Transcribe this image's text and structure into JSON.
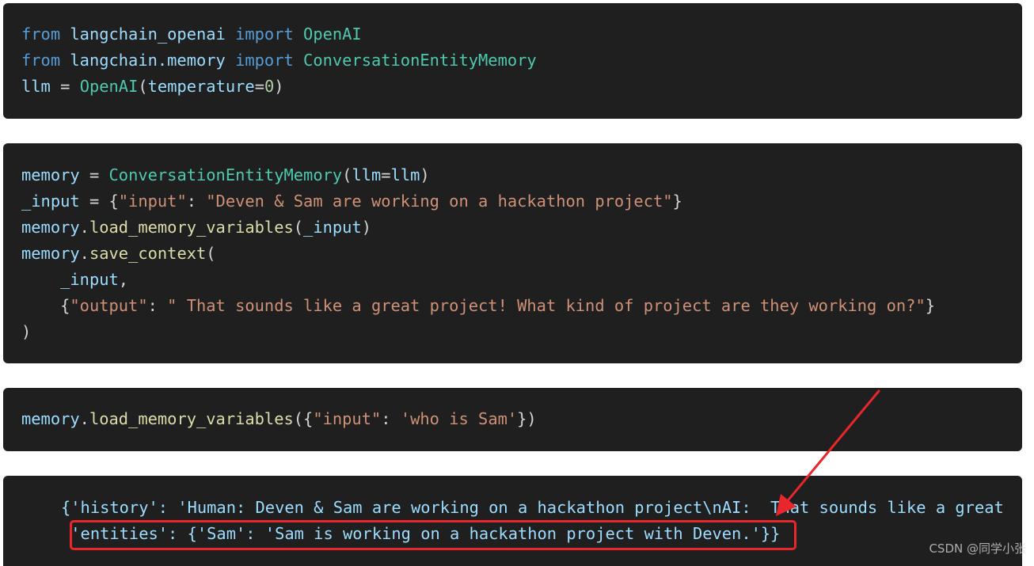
{
  "cells": [
    {
      "lines": [
        [
          {
            "t": "from",
            "c": "kw"
          },
          {
            "t": " langchain_openai ",
            "c": "var"
          },
          {
            "t": "import",
            "c": "kw"
          },
          {
            "t": " OpenAI",
            "c": "cls"
          }
        ],
        [
          {
            "t": "from",
            "c": "kw"
          },
          {
            "t": " langchain.memory ",
            "c": "var"
          },
          {
            "t": "import",
            "c": "kw"
          },
          {
            "t": " ConversationEntityMemory",
            "c": "cls"
          }
        ],
        [
          {
            "t": "llm",
            "c": "var"
          },
          {
            "t": " = ",
            "c": "pun"
          },
          {
            "t": "OpenAI",
            "c": "cls"
          },
          {
            "t": "(",
            "c": "pun"
          },
          {
            "t": "temperature",
            "c": "var"
          },
          {
            "t": "=",
            "c": "pun"
          },
          {
            "t": "0",
            "c": "num"
          },
          {
            "t": ")",
            "c": "pun"
          }
        ]
      ]
    },
    {
      "lines": [
        [
          {
            "t": "memory",
            "c": "var"
          },
          {
            "t": " = ",
            "c": "pun"
          },
          {
            "t": "ConversationEntityMemory",
            "c": "cls"
          },
          {
            "t": "(",
            "c": "pun"
          },
          {
            "t": "llm",
            "c": "var"
          },
          {
            "t": "=",
            "c": "pun"
          },
          {
            "t": "llm",
            "c": "var"
          },
          {
            "t": ")",
            "c": "pun"
          }
        ],
        [
          {
            "t": "_input",
            "c": "var"
          },
          {
            "t": " = {",
            "c": "pun"
          },
          {
            "t": "\"input\"",
            "c": "str"
          },
          {
            "t": ": ",
            "c": "pun"
          },
          {
            "t": "\"Deven & Sam are working on a hackathon project\"",
            "c": "str"
          },
          {
            "t": "}",
            "c": "pun"
          }
        ],
        [
          {
            "t": "memory",
            "c": "var"
          },
          {
            "t": ".",
            "c": "pun"
          },
          {
            "t": "load_memory_variables",
            "c": "fn"
          },
          {
            "t": "(",
            "c": "pun"
          },
          {
            "t": "_input",
            "c": "var"
          },
          {
            "t": ")",
            "c": "pun"
          }
        ],
        [
          {
            "t": "memory",
            "c": "var"
          },
          {
            "t": ".",
            "c": "pun"
          },
          {
            "t": "save_context",
            "c": "fn"
          },
          {
            "t": "(",
            "c": "pun"
          }
        ],
        [
          {
            "t": "    ",
            "c": "pun"
          },
          {
            "t": "_input",
            "c": "var"
          },
          {
            "t": ",",
            "c": "pun"
          }
        ],
        [
          {
            "t": "    {",
            "c": "pun"
          },
          {
            "t": "\"output\"",
            "c": "str"
          },
          {
            "t": ": ",
            "c": "pun"
          },
          {
            "t": "\" That sounds like a great project! What kind of project are they working on?\"",
            "c": "str"
          },
          {
            "t": "}",
            "c": "pun"
          }
        ],
        [
          {
            "t": ")",
            "c": "pun"
          }
        ]
      ]
    },
    {
      "lines": [
        [
          {
            "t": "memory",
            "c": "var"
          },
          {
            "t": ".",
            "c": "pun"
          },
          {
            "t": "load_memory_variables",
            "c": "fn"
          },
          {
            "t": "({",
            "c": "pun"
          },
          {
            "t": "\"input\"",
            "c": "str"
          },
          {
            "t": ": ",
            "c": "pun"
          },
          {
            "t": "'who is Sam'",
            "c": "str"
          },
          {
            "t": "})",
            "c": "pun"
          }
        ]
      ]
    },
    {
      "lines": [
        [
          {
            "t": "{'history': 'Human: Deven & Sam are working on a hackathon project\\nAI:  That sounds like a great",
            "c": "var"
          }
        ],
        [
          {
            "t": " 'entities': {'Sam': 'Sam is working on a hackathon project with Deven.'}}",
            "c": "var"
          }
        ]
      ]
    }
  ],
  "watermark": "CSDN @同学小张",
  "colors": {
    "cell_background": "#1f1f1f",
    "highlight": "#e8262b"
  }
}
